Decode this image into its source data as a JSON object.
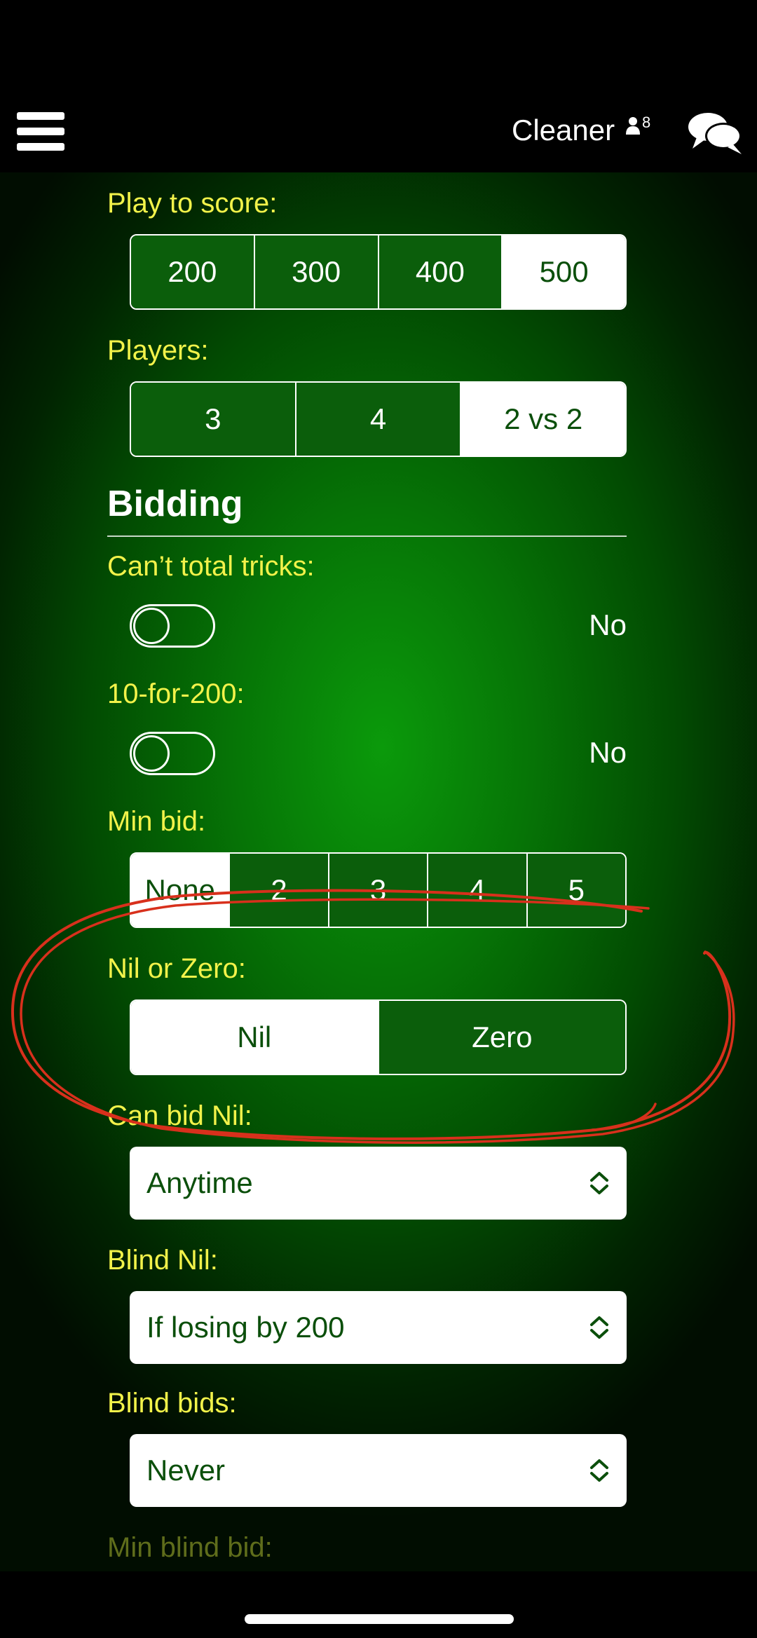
{
  "header": {
    "user_name": "Cleaner",
    "users_count": "8",
    "icons": [
      "menu-icon",
      "users-icon",
      "chat-icon"
    ]
  },
  "settings": {
    "play_to_score": {
      "label": "Play to score:",
      "options": [
        "200",
        "300",
        "400",
        "500"
      ],
      "selected": "500"
    },
    "players": {
      "label": "Players:",
      "options": [
        "3",
        "4",
        "2 vs 2"
      ],
      "selected": "2 vs 2"
    },
    "bidding_title": "Bidding",
    "cant_total_tricks": {
      "label": "Can’t total tricks:",
      "value": "No"
    },
    "ten_for_200": {
      "label": "10-for-200:",
      "value": "No"
    },
    "min_bid": {
      "label": "Min bid:",
      "options": [
        "None",
        "2",
        "3",
        "4",
        "5"
      ],
      "selected": "None"
    },
    "nil_or_zero": {
      "label": "Nil or Zero:",
      "options": [
        "Nil",
        "Zero"
      ],
      "selected": "Nil"
    },
    "can_bid_nil": {
      "label": "Can bid Nil:",
      "value": "Anytime"
    },
    "blind_nil": {
      "label": "Blind Nil:",
      "value": "If losing by 200"
    },
    "blind_bids": {
      "label": "Blind bids:",
      "value": "Never"
    },
    "min_blind_bid": {
      "label": "Min blind bid:"
    }
  },
  "colors": {
    "label_yellow": "#f2f24a",
    "green_bg": "#067506",
    "selected_bg": "#ffffff",
    "annotation_red": "#d8301c"
  }
}
